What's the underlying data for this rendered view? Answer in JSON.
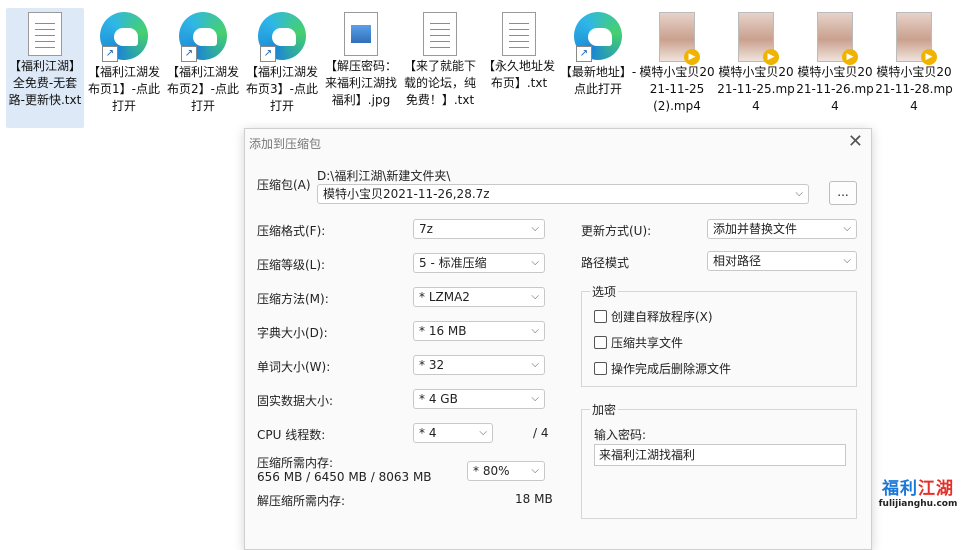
{
  "desktop": {
    "icons": [
      {
        "type": "txt",
        "label": "【福利江湖】全免费-无套路-更新快.txt",
        "selected": true
      },
      {
        "type": "edge",
        "label": "【福利江湖发布页1】-点此打开"
      },
      {
        "type": "edge",
        "label": "【福利江湖发布页2】-点此打开"
      },
      {
        "type": "edge",
        "label": "【福利江湖发布页3】-点此打开"
      },
      {
        "type": "jpg",
        "label": "【解压密码：来福利江湖找福利】.jpg"
      },
      {
        "type": "txt",
        "label": "【来了就能下载的论坛，纯免费！】.txt"
      },
      {
        "type": "txt",
        "label": "【永久地址发布页】.txt"
      },
      {
        "type": "edge",
        "label": "【最新地址】-点此打开"
      },
      {
        "type": "video",
        "label": "模特小宝贝2021-11-25 (2).mp4"
      },
      {
        "type": "video",
        "label": "模特小宝贝2021-11-25.mp4"
      },
      {
        "type": "video",
        "label": "模特小宝贝2021-11-26.mp4"
      },
      {
        "type": "video",
        "label": "模特小宝贝2021-11-28.mp4"
      }
    ]
  },
  "dialog": {
    "title": "添加到压缩包",
    "close_symbol": "✕",
    "archive_label": "压缩包(A)",
    "archive_path": "D:\\福利江湖\\新建文件夹\\",
    "archive_name": "模特小宝贝2021-11-26,28.7z",
    "browse_label": "...",
    "format_label": "压缩格式(F):",
    "format_value": "7z",
    "level_label": "压缩等级(L):",
    "level_value": "5 - 标准压缩",
    "method_label": "压缩方法(M):",
    "method_value": "*  LZMA2",
    "dict_label": "字典大小(D):",
    "dict_value": "*  16 MB",
    "word_label": "单词大小(W):",
    "word_value": "*  32",
    "solid_label": "固实数据大小:",
    "solid_value": "*  4 GB",
    "cpu_label": "CPU 线程数:",
    "cpu_value": "*  4",
    "cpu_total": "/ 4",
    "mem_label": "压缩所需内存:",
    "mem_value": "656 MB / 6450 MB / 8063 MB",
    "mem_percent": "* 80%",
    "decomp_label": "解压缩所需内存:",
    "decomp_value": "18 MB",
    "update_label": "更新方式(U):",
    "update_value": "添加并替换文件",
    "pathmode_label": "路径模式",
    "pathmode_value": "相对路径",
    "options_title": "选项",
    "opt_sfx": "创建自释放程序(X)",
    "opt_shared": "压缩共享文件",
    "opt_delete": "操作完成后删除源文件",
    "encrypt_title": "加密",
    "password_label": "输入密码:",
    "password_value": "来福利江湖找福利"
  },
  "watermark": {
    "main_left": "福利",
    "main_right": "江湖",
    "sub": "fulijianghu.com"
  }
}
